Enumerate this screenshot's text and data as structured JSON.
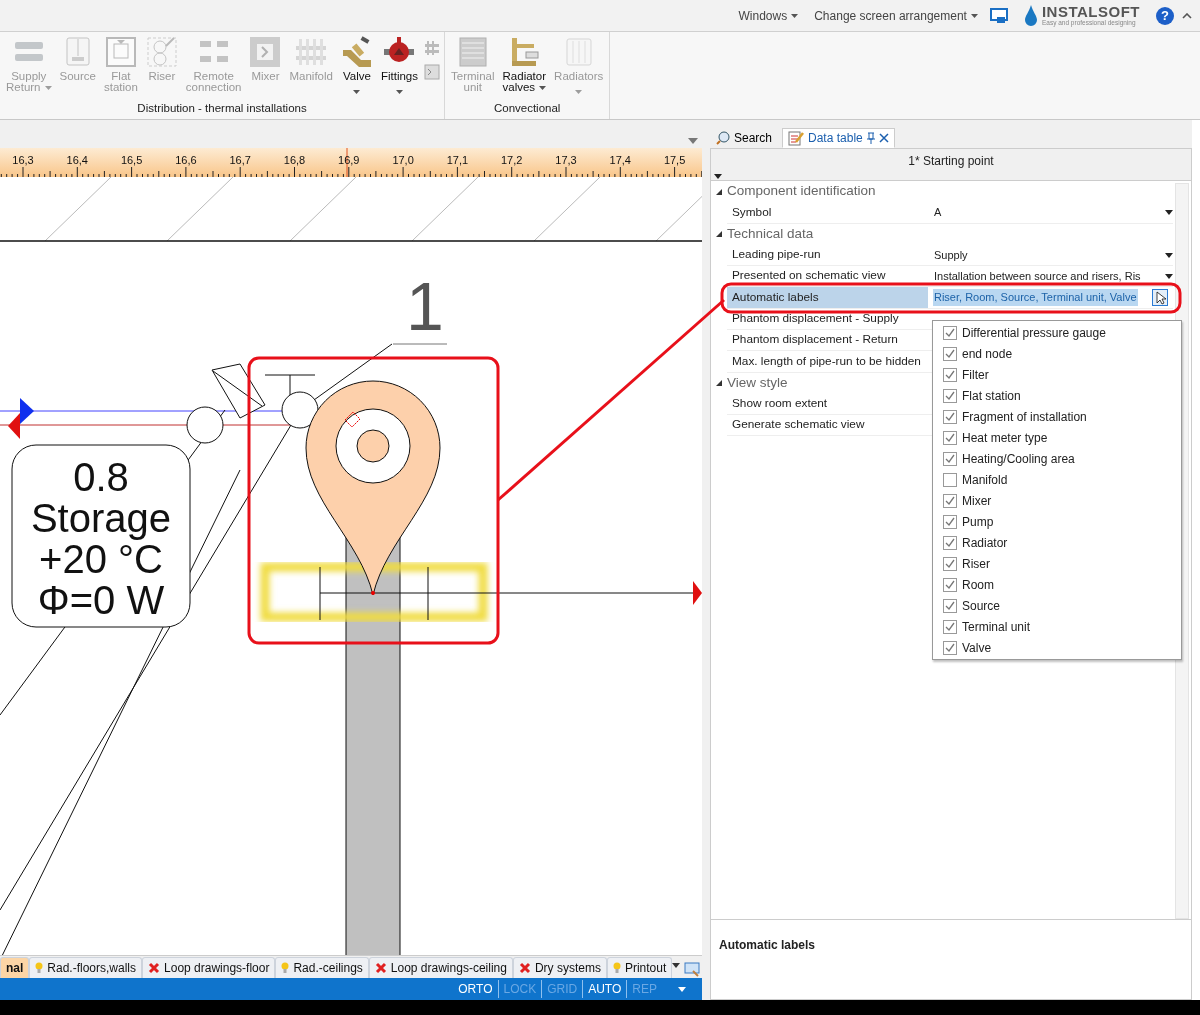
{
  "menu": [
    {
      "label": "Windows",
      "dropdown": true
    },
    {
      "label": "Change screen arrangement",
      "dropdown": true
    }
  ],
  "logo": {
    "name": "INSTALSOFT",
    "tagline": "Easy and professional designing"
  },
  "help_button": "?",
  "ribbon": {
    "groups": [
      {
        "label": "Distribution - thermal installations",
        "items": [
          {
            "label": [
              "Supply",
              "Return"
            ],
            "enabled": false,
            "dropdown": true
          },
          {
            "label": [
              "Source"
            ],
            "enabled": false,
            "dropdown": false
          },
          {
            "label": [
              "Flat",
              "station"
            ],
            "enabled": false,
            "dropdown": false
          },
          {
            "label": [
              "Riser"
            ],
            "enabled": false,
            "dropdown": false
          },
          {
            "label": [
              "Remote",
              "connection"
            ],
            "enabled": false,
            "dropdown": false
          },
          {
            "label": [
              "Mixer"
            ],
            "enabled": false,
            "dropdown": false
          },
          {
            "label": [
              "Manifold"
            ],
            "enabled": false,
            "dropdown": false
          },
          {
            "label": [
              "Valve"
            ],
            "enabled": true,
            "dropdown": true
          },
          {
            "label": [
              "Fittings"
            ],
            "enabled": true,
            "dropdown": true
          }
        ]
      },
      {
        "label": "Convectional",
        "items": [
          {
            "label": [
              "Terminal",
              "unit"
            ],
            "enabled": false,
            "dropdown": false
          },
          {
            "label": [
              "Radiator",
              "valves"
            ],
            "enabled": true,
            "dropdown": true
          },
          {
            "label": [
              "Radiators"
            ],
            "enabled": false,
            "dropdown": true
          }
        ]
      }
    ]
  },
  "drawing": {
    "ruler_labels": [
      "16,3",
      "16,4",
      "16,5",
      "16,6",
      "16,7",
      "16,8",
      "16,9",
      "17,0",
      "17,1",
      "17,2",
      "17,3",
      "17,4",
      "17,5"
    ],
    "node_number": "1",
    "node_label": [
      "0.8",
      "Storage",
      "+20 °C",
      "Φ=0 W"
    ]
  },
  "sheet_tabs": [
    {
      "label": "nal",
      "kind": "plain",
      "selected": true
    },
    {
      "label": "Rad.-floors,walls",
      "kind": "bulb",
      "selected": false
    },
    {
      "label": "Loop drawings-floor",
      "kind": "error",
      "selected": false
    },
    {
      "label": "Rad.-ceilings",
      "kind": "bulb",
      "selected": false
    },
    {
      "label": "Loop drawings-ceiling",
      "kind": "error",
      "selected": false
    },
    {
      "label": "Dry systems",
      "kind": "error",
      "selected": false
    },
    {
      "label": "Printout",
      "kind": "bulb",
      "selected": false
    }
  ],
  "status_bar": [
    {
      "label": "ORTO",
      "on": true
    },
    {
      "label": "LOCK",
      "on": false
    },
    {
      "label": "GRID",
      "on": false
    },
    {
      "label": "AUTO",
      "on": true
    },
    {
      "label": "REP",
      "on": false
    }
  ],
  "panel": {
    "tabs": [
      {
        "label": "Search",
        "selected": false
      },
      {
        "label": "Data table",
        "selected": true
      }
    ],
    "title": "1* Starting point",
    "groups": [
      {
        "label": "Component identification",
        "expanded": true,
        "rows": [
          {
            "label": "Symbol",
            "value": "A",
            "kind": "dropdown",
            "selected": false
          }
        ]
      },
      {
        "label": "Technical data",
        "expanded": true,
        "rows": [
          {
            "label": "Leading pipe-run",
            "value": "Supply",
            "kind": "dropdown",
            "selected": false
          },
          {
            "label": "Presented on schematic view",
            "value": "Installation between source and risers, Ris",
            "kind": "dropdown",
            "selected": false
          },
          {
            "label": "Automatic labels",
            "value": "Riser, Room, Source, Terminal unit, Valve",
            "kind": "popup",
            "selected": true
          },
          {
            "label": "Phantom displacement - Supply",
            "kind": "text",
            "selected": false
          },
          {
            "label": "Phantom displacement - Return",
            "kind": "text",
            "selected": false
          },
          {
            "label": "Max. length of pipe-run to be hidden",
            "kind": "text",
            "selected": false
          }
        ]
      },
      {
        "label": "View style",
        "expanded": true,
        "rows": [
          {
            "label": "Show room extent",
            "kind": "text",
            "selected": false
          },
          {
            "label": "Generate schematic view",
            "kind": "text",
            "selected": false
          }
        ]
      }
    ],
    "description": "Automatic labels",
    "dropdown_list": [
      {
        "label": "Differential pressure gauge",
        "checked": true
      },
      {
        "label": "end node",
        "checked": true
      },
      {
        "label": "Filter",
        "checked": true
      },
      {
        "label": "Flat station",
        "checked": true
      },
      {
        "label": "Fragment of installation",
        "checked": true
      },
      {
        "label": "Heat meter type",
        "checked": true
      },
      {
        "label": "Heating/Cooling area",
        "checked": true
      },
      {
        "label": "Manifold",
        "checked": false
      },
      {
        "label": "Mixer",
        "checked": true
      },
      {
        "label": "Pump",
        "checked": true
      },
      {
        "label": "Radiator",
        "checked": true
      },
      {
        "label": "Riser",
        "checked": true
      },
      {
        "label": "Room",
        "checked": true
      },
      {
        "label": "Source",
        "checked": true
      },
      {
        "label": "Terminal unit",
        "checked": true
      },
      {
        "label": "Valve",
        "checked": true
      }
    ]
  }
}
